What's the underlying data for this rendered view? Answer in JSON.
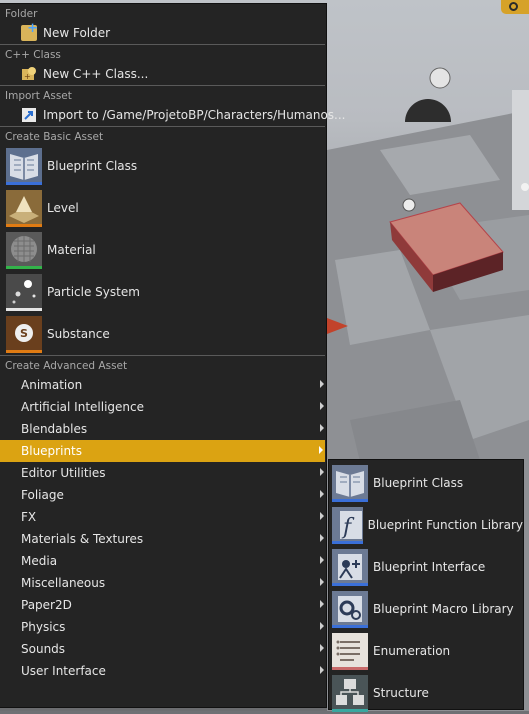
{
  "menu": {
    "sections": {
      "folder": "Folder",
      "cpp": "C++ Class",
      "import": "Import Asset",
      "basic": "Create Basic Asset",
      "advanced": "Create Advanced Asset"
    },
    "new_folder": "New Folder",
    "new_cpp_class": "New C++ Class...",
    "import_to": "Import to /Game/ProjetoBP/Characters/Humanos...",
    "basic_assets": [
      {
        "label": "Blueprint Class",
        "icon": "blueprint-class-icon",
        "accent": "#3a6fd8"
      },
      {
        "label": "Level",
        "icon": "level-icon",
        "accent": "#e07b13"
      },
      {
        "label": "Material",
        "icon": "material-icon",
        "accent": "#33b34a"
      },
      {
        "label": "Particle System",
        "icon": "particle-system-icon",
        "accent": "#e6e6e6"
      },
      {
        "label": "Substance",
        "icon": "substance-icon",
        "accent": "#e07b13"
      }
    ],
    "advanced_categories": [
      "Animation",
      "Artificial Intelligence",
      "Blendables",
      "Blueprints",
      "Editor Utilities",
      "Foliage",
      "FX",
      "Materials & Textures",
      "Media",
      "Miscellaneous",
      "Paper2D",
      "Physics",
      "Sounds",
      "User Interface"
    ],
    "active_category": "Blueprints",
    "highlight_color": "#dba312"
  },
  "submenu": {
    "items": [
      {
        "label": "Blueprint Class",
        "icon": "blueprint-class-icon"
      },
      {
        "label": "Blueprint Function Library",
        "icon": "blueprint-function-library-icon"
      },
      {
        "label": "Blueprint Interface",
        "icon": "blueprint-interface-icon"
      },
      {
        "label": "Blueprint Macro Library",
        "icon": "blueprint-macro-library-icon"
      },
      {
        "label": "Enumeration",
        "icon": "enumeration-icon"
      },
      {
        "label": "Structure",
        "icon": "structure-icon"
      }
    ]
  }
}
